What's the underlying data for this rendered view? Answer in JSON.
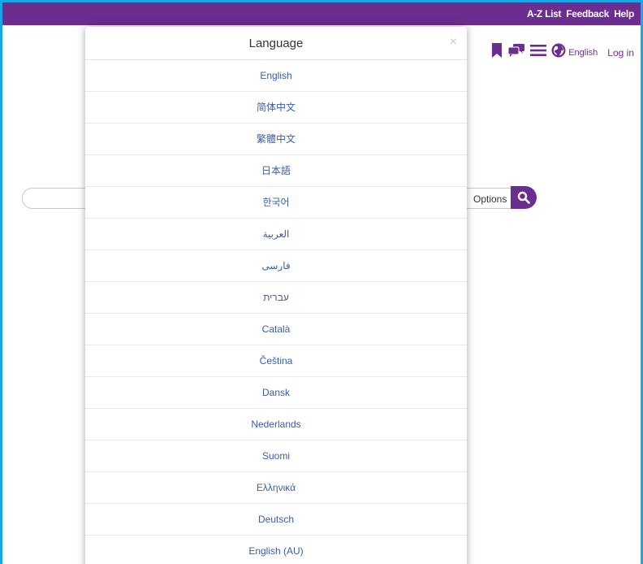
{
  "topbar": {
    "links": [
      "A-Z List",
      "Feedback",
      "Help"
    ]
  },
  "header": {
    "language_label": "English",
    "login_label": "Log in",
    "icons": [
      "bookmark-icon",
      "chat-bubbles-icon",
      "menu-icon",
      "globe-icon"
    ]
  },
  "search": {
    "options_label": "Options",
    "placeholder": ""
  },
  "modal": {
    "title": "Language",
    "close_label": "×",
    "languages": [
      "English",
      "简体中文",
      "繁體中文",
      "日本語",
      "한국어",
      "العربية",
      "فارسی",
      "עברית",
      "Català",
      "Čeština",
      "Dansk",
      "Nederlands",
      "Suomi",
      "Ελληνικά",
      "Deutsch",
      "English (AU)"
    ]
  },
  "colors": {
    "brand": "#6b2d8f",
    "link": "#3a5da8",
    "frame": "#1aa7e8"
  }
}
